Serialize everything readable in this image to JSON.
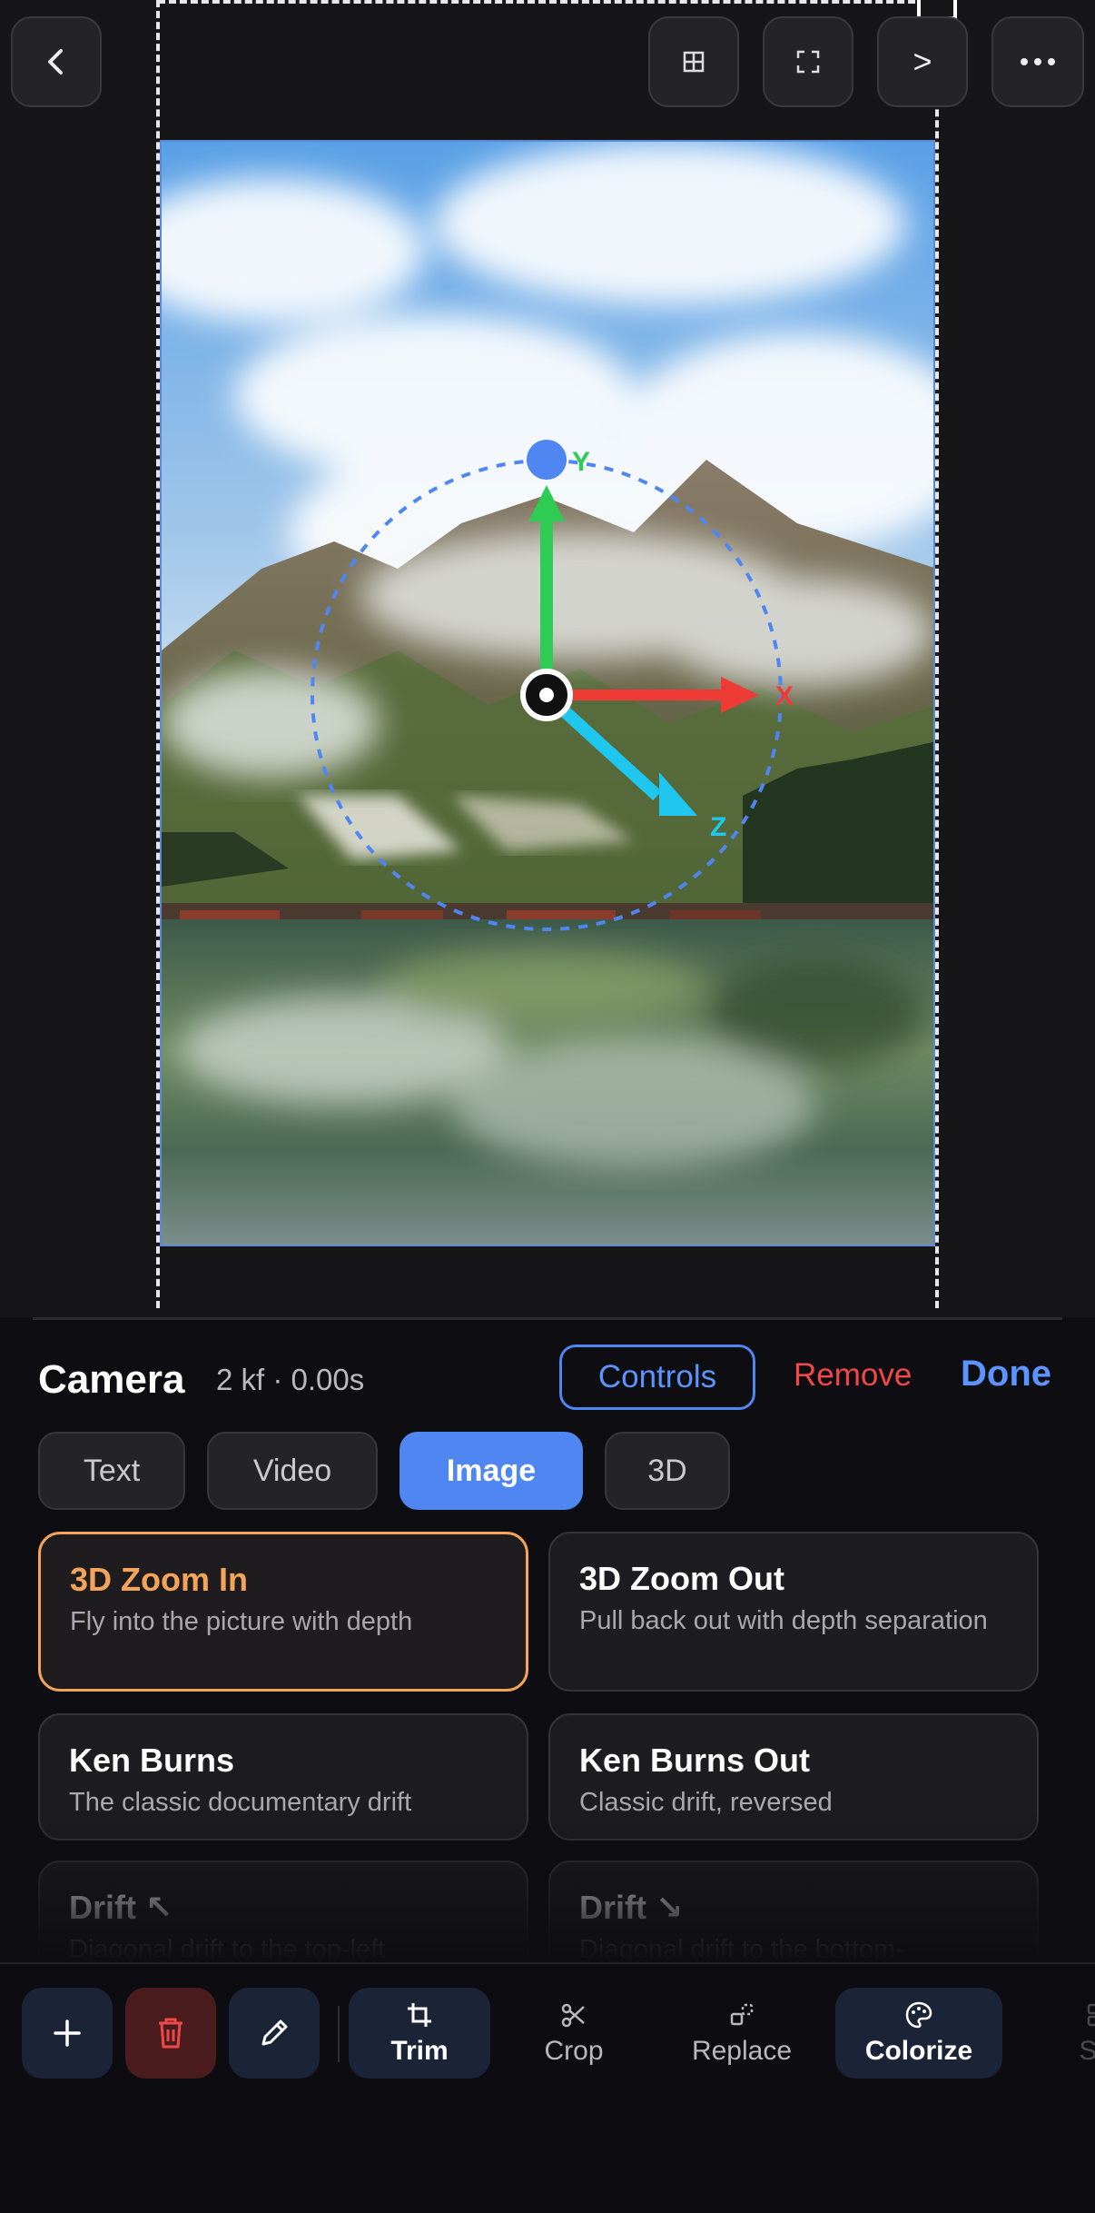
{
  "topbar": {
    "back_icon": "chevron-left-icon",
    "grid_icon": "grid-icon",
    "fullscreen_icon": "fullscreen-icon",
    "next_label": ">",
    "more_icon": "more-dots-icon"
  },
  "gizmo": {
    "axis_y": "Y",
    "axis_x": "X",
    "axis_z": "Z",
    "colors": {
      "y": "#2ecc53",
      "x": "#ef3b35",
      "z": "#1fc6ee",
      "orbit": "#4f86f2"
    }
  },
  "camera": {
    "title": "Camera",
    "meta": "2 kf · 0.00s",
    "controls_label": "Controls",
    "remove_label": "Remove",
    "done_label": "Done"
  },
  "tabs": [
    {
      "label": "Text",
      "active": false
    },
    {
      "label": "Video",
      "active": false
    },
    {
      "label": "Image",
      "active": true
    },
    {
      "label": "3D",
      "active": false
    }
  ],
  "presets": [
    {
      "title": "3D Zoom In",
      "desc": "Fly into the picture with depth",
      "selected": true
    },
    {
      "title": "3D Zoom Out",
      "desc": "Pull back out with depth separation",
      "selected": false
    },
    {
      "title": "Ken Burns",
      "desc": "The classic documentary drift",
      "selected": false
    },
    {
      "title": "Ken Burns Out",
      "desc": "Classic drift, reversed",
      "selected": false
    },
    {
      "title": "Drift ↖",
      "desc": "Diagonal drift to the top-left",
      "selected": false
    },
    {
      "title": "Drift ↘",
      "desc": "Diagonal drift to the bottom-",
      "selected": false
    }
  ],
  "toolbar": {
    "add_icon": "plus-icon",
    "delete_icon": "trash-icon",
    "edit_icon": "pencil-icon",
    "tools": [
      {
        "label": "Trim",
        "icon": "crop-icon",
        "active": true
      },
      {
        "label": "Crop",
        "icon": "scissors-icon",
        "active": false
      },
      {
        "label": "Replace",
        "icon": "replace-icon",
        "active": false
      },
      {
        "label": "Colorize",
        "icon": "palette-icon",
        "active": true
      },
      {
        "label": "Spl",
        "icon": "split-icon",
        "active": false
      }
    ]
  },
  "accent": {
    "blue": "#4f86f2",
    "orange": "#f3a45a",
    "red": "#f04848"
  }
}
